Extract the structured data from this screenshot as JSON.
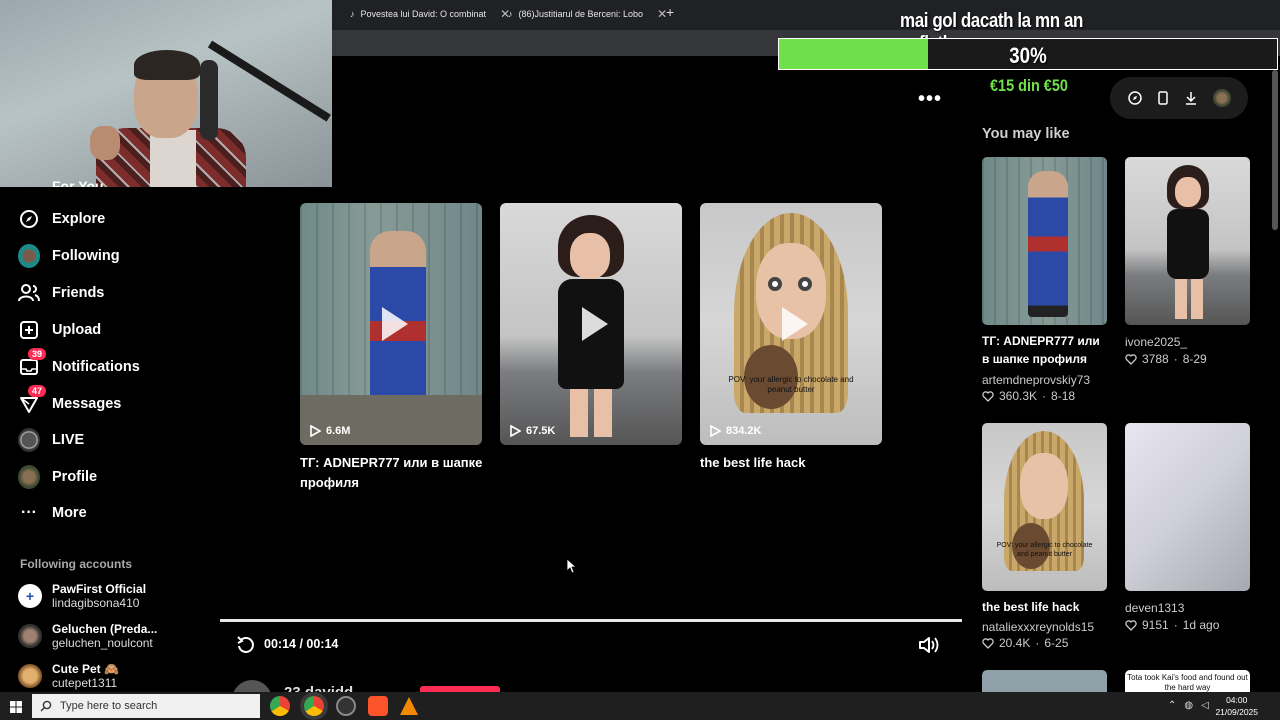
{
  "browser": {
    "tabs": [
      {
        "label": "Povestea lui David: O combinat"
      },
      {
        "label": "(86)Justitiarul de Berceni: Lobo"
      }
    ]
  },
  "overlay": {
    "donation_title": "mai gol dacath la mn an sufleth",
    "donation_percent": "30%",
    "donation_fraction": 0.3,
    "donation_amount": "€15 din €50"
  },
  "sidebar": {
    "partial_top": "For You",
    "items": [
      {
        "label": "Explore"
      },
      {
        "label": "Following"
      },
      {
        "label": "Friends"
      },
      {
        "label": "Upload"
      },
      {
        "label": "Notifications",
        "badge": "39"
      },
      {
        "label": "Messages",
        "badge": "47"
      },
      {
        "label": "LIVE"
      },
      {
        "label": "Profile"
      },
      {
        "label": "More"
      }
    ],
    "following_heading": "Following accounts",
    "accounts": [
      {
        "name": "PawFirst Official",
        "user": "lindagibsona410"
      },
      {
        "name": "Geluchen (Preda...",
        "user": "geluchen_noulcont"
      },
      {
        "name": "Cute Pet 🙈",
        "user": "cutepet1311"
      }
    ]
  },
  "main": {
    "videos": [
      {
        "title": "ТГ: ADNEPR777 или в шапке профиля",
        "views": "6.6M"
      },
      {
        "title": "",
        "views": "67.5K"
      },
      {
        "title": "the best life hack",
        "views": "834.2K",
        "caption": "POV: your allergic to chocolate and peanut butter"
      }
    ],
    "time": "00:14 / 00:14",
    "author_partial": "23 davidd"
  },
  "right": {
    "heading": "You may like",
    "cards": [
      {
        "title": "ТГ: ADNEPR777 или в шапке профиля",
        "user": "artemdneprovskiy73",
        "likes": "360.3K",
        "date": "8-18"
      },
      {
        "title": "",
        "user": "ivone2025_",
        "likes": "3788",
        "date": "8-29"
      },
      {
        "title": "the best life hack",
        "user": "nataliexxxreynolds15",
        "likes": "20.4K",
        "date": "6-25",
        "caption": "POV: your allergic to chocolate and peanut butter"
      },
      {
        "title": "",
        "user": "deven1313",
        "likes": "9151",
        "date": "1d ago"
      }
    ],
    "partial_caption": "Tota took Kai's food and found out the hard way"
  },
  "taskbar": {
    "search_placeholder": "Type here to search",
    "time": "04:00",
    "date": "21/09/2025"
  }
}
